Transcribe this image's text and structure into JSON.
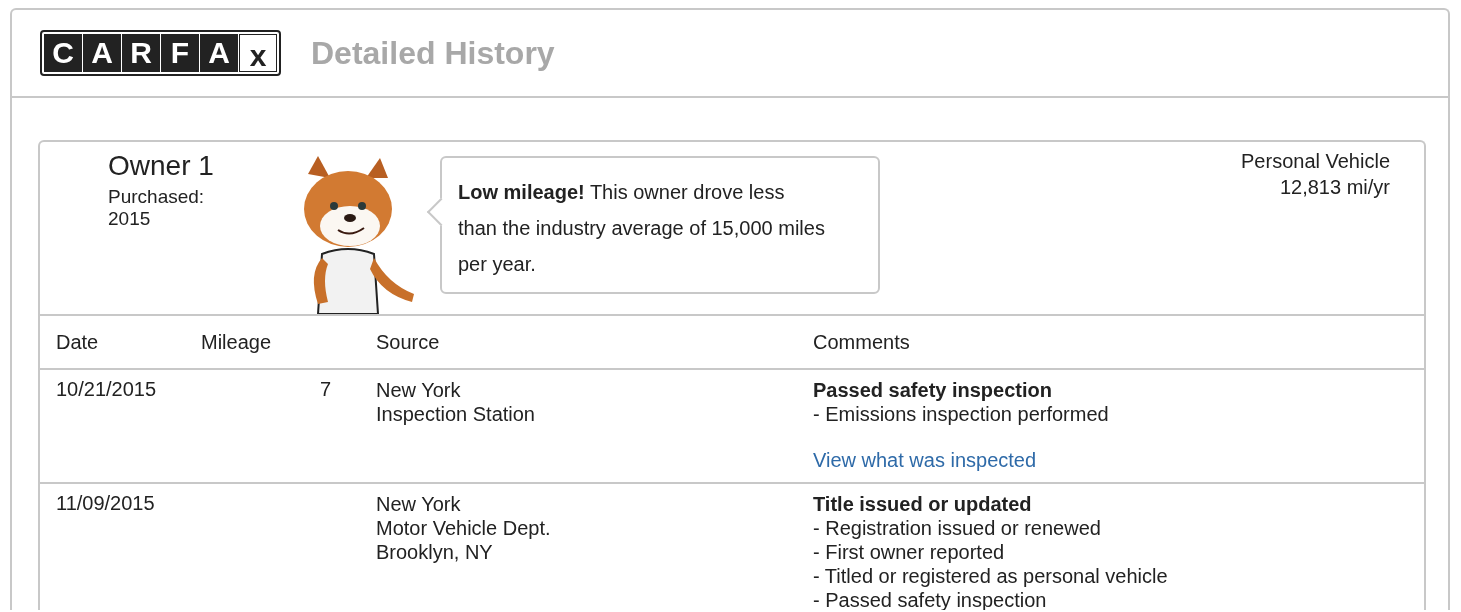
{
  "header": {
    "logo": [
      {
        "char": "C",
        "inverted": false
      },
      {
        "char": "A",
        "inverted": false
      },
      {
        "char": "R",
        "inverted": false
      },
      {
        "char": "F",
        "inverted": false
      },
      {
        "char": "A",
        "inverted": false
      },
      {
        "char": "x",
        "inverted": true
      }
    ],
    "title": "Detailed History"
  },
  "owner": {
    "name": "Owner 1",
    "purchased_label": "Purchased:",
    "purchased_year": "2015",
    "tip": "**Low mileage!** This owner drove less than the industry average of 15,000 miles per year.",
    "usage": "Personal Vehicle",
    "mileage_rate": "12,813 mi/yr"
  },
  "table": {
    "columns": [
      "Date",
      "Mileage",
      "Source",
      "Comments"
    ],
    "rows": [
      {
        "date": "10/21/2015",
        "mileage": "7",
        "source": [
          "New York",
          "Inspection Station"
        ],
        "comment_title": "Passed safety inspection",
        "comment_details": [
          "- Emissions inspection performed"
        ],
        "link": "View what was inspected"
      },
      {
        "date": "11/09/2015",
        "source": [
          "New York",
          "Motor Vehicle Dept.",
          "Brooklyn, NY"
        ],
        "comment_title": "Title issued or updated",
        "comment_details": [
          "- Registration issued or renewed",
          "- First owner reported",
          "- Titled or registered as personal vehicle",
          "- Passed safety inspection"
        ]
      }
    ]
  }
}
